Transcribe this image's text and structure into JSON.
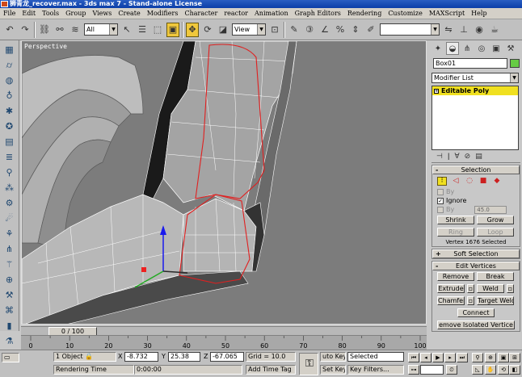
{
  "window": {
    "title": "狮青龙_recover.max - 3ds max 7 - Stand-alone License"
  },
  "menu": [
    "File",
    "Edit",
    "Tools",
    "Group",
    "Views",
    "Create",
    "Modifiers",
    "Character",
    "reactor",
    "Animation",
    "Graph Editors",
    "Rendering",
    "Customize",
    "MAXScript",
    "Help"
  ],
  "toolbar": {
    "selection_filter": "All",
    "ref_coord": "View",
    "named_selection": ""
  },
  "viewport": {
    "label": "Perspective"
  },
  "command_panel": {
    "object_name": "Box01",
    "object_color": "#66cc44",
    "modifier_list_label": "Modifier List",
    "stack_item": "Editable Poly",
    "selection": {
      "title": "Selection",
      "by_vertex_label": "By",
      "ignore_label": "Ignore",
      "ignore_checked": true,
      "by_angle_label": "By",
      "angle_value": "45.0",
      "shrink": "Shrink",
      "grow": "Grow",
      "ring": "Ring",
      "loop": "Loop",
      "status": "Vertex 1676 Selected"
    },
    "soft_selection": {
      "title": "Soft Selection"
    },
    "edit_vertices": {
      "title": "Edit Vertices",
      "remove": "Remove",
      "break": "Break",
      "extrude": "Extrude",
      "weld": "Weld",
      "chamfer": "Chamfer",
      "target_weld": "Target Weld",
      "connect": "Connect",
      "remove_isolated": "emove Isolated Vertice"
    }
  },
  "timeline": {
    "slider_label": "0 / 100",
    "ticks": [
      "0",
      "10",
      "20",
      "30",
      "40",
      "50",
      "60",
      "70",
      "80",
      "90",
      "100"
    ]
  },
  "status": {
    "selected_count": "1 Object",
    "x_label": "X",
    "x_value": "-8.732",
    "y_label": "Y",
    "y_value": "25.38",
    "z_label": "Z",
    "z_value": "-67.065",
    "grid": "Grid = 10.0",
    "rendering_label": "Rendering Time",
    "rendering_time": "0:00:00",
    "add_time_tag": "Add Time Tag",
    "auto_key": "uto Key",
    "set_key": "Set Key",
    "key_mode": "Selected",
    "key_filters": "Key Filters..."
  }
}
